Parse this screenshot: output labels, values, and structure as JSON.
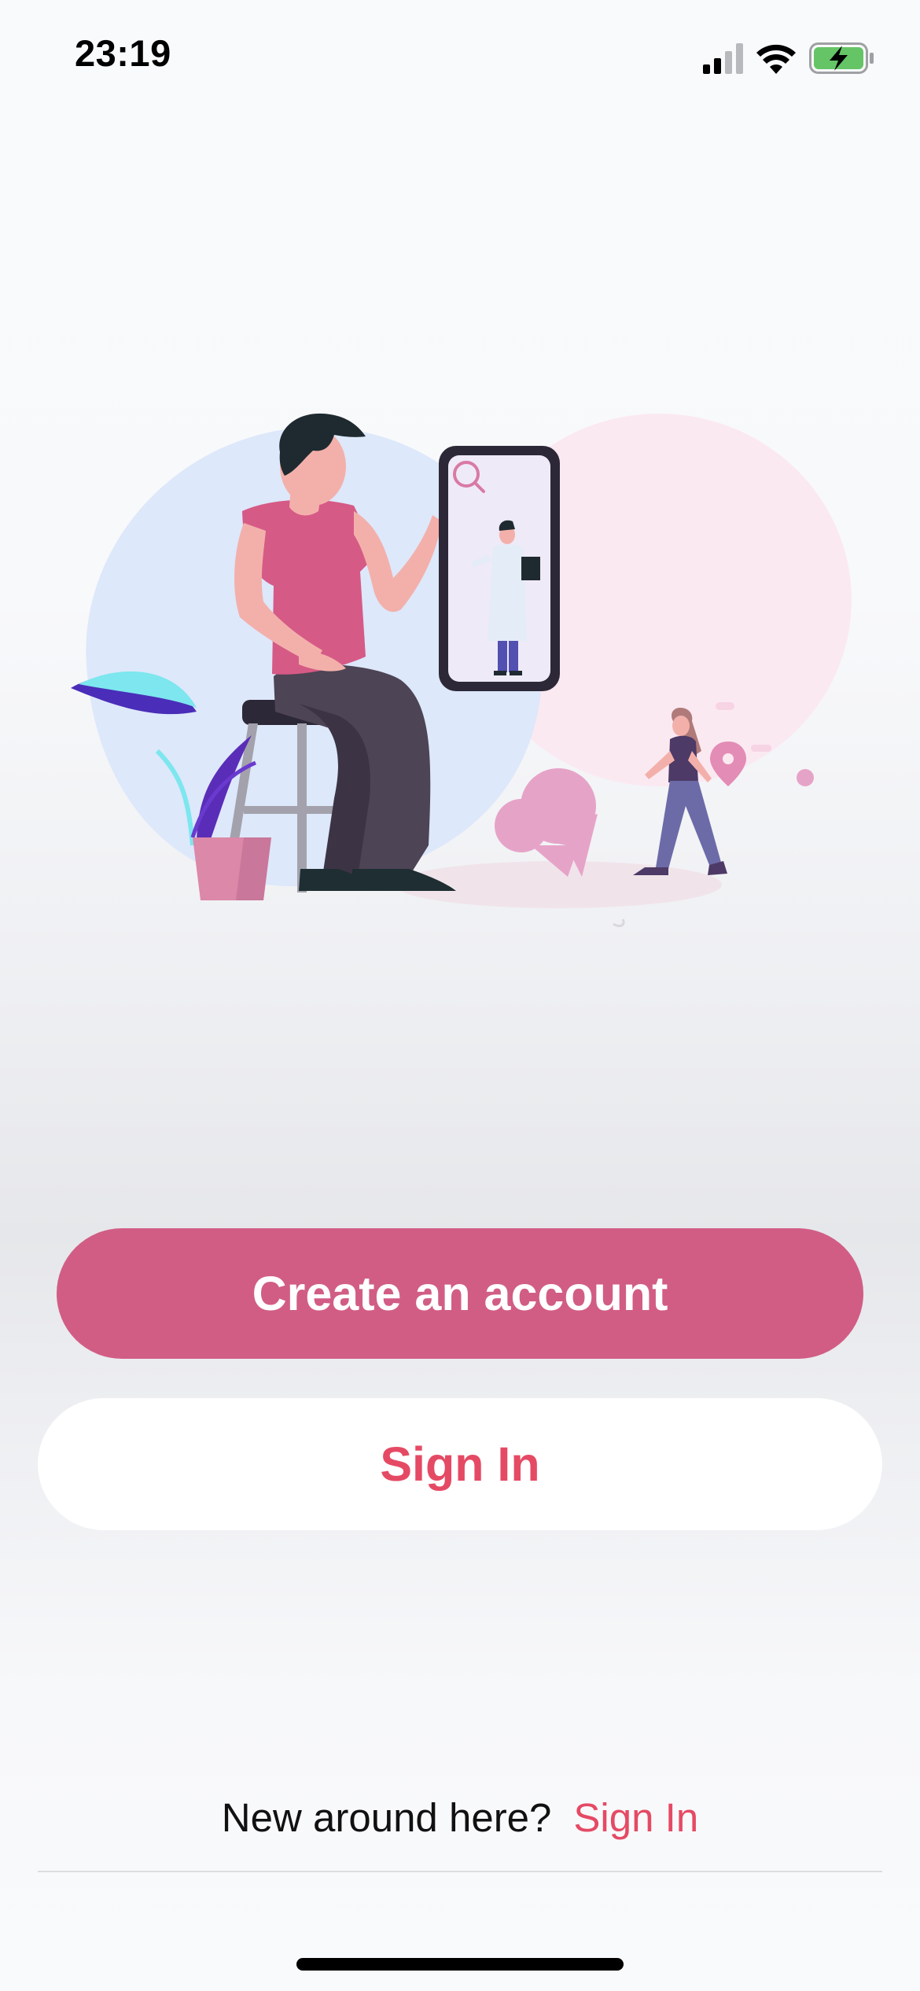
{
  "status_bar": {
    "time": "23:19",
    "icons": [
      "cellular-signal-icon",
      "wifi-icon",
      "battery-charging-icon"
    ],
    "battery_color": "#65c466"
  },
  "illustration": {
    "description_icons": [
      "man-on-stool",
      "phone-with-doctor",
      "search-icon",
      "plant",
      "woman-walking",
      "location-pin-icon",
      "chat-bubble-icon"
    ]
  },
  "actions": {
    "create_account_label": "Create an account",
    "sign_in_label": "Sign In"
  },
  "footer": {
    "prompt_text": "New around here?",
    "link_label": "Sign In"
  },
  "colors": {
    "primary": "#d15d85",
    "accent_text": "#e54a64",
    "background": "#f8f9fb"
  }
}
